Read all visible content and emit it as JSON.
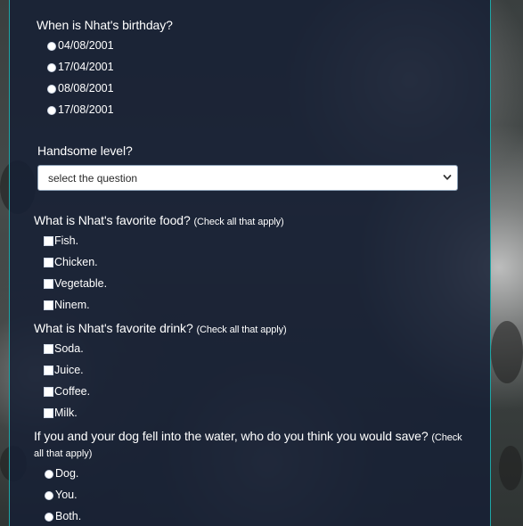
{
  "questions": {
    "birthday": {
      "label": "When is Nhat's birthday?",
      "options": [
        "04/08/2001",
        "17/04/2001",
        "08/08/2001",
        "17/08/2001"
      ]
    },
    "handsome": {
      "label": "Handsome level?",
      "select_value": "select the question"
    },
    "food": {
      "label": "What is Nhat's favorite food?",
      "note": "(Check all that apply)",
      "options": [
        "Fish.",
        "Chicken.",
        "Vegetable.",
        "Ninem."
      ]
    },
    "drink": {
      "label": "What is Nhat's favorite drink?",
      "note": "(Check all that apply)",
      "options": [
        "Soda.",
        "Juice.",
        "Coffee.",
        "Milk."
      ]
    },
    "dog": {
      "label": "If you and your dog fell into the water, who do you think you would save?",
      "note_part1": "(Check",
      "note_part2": "all that apply)",
      "options": [
        "Dog.",
        "You.",
        "Both."
      ]
    }
  },
  "icons": {
    "select_chevron": "chevron-down-icon"
  },
  "colors": {
    "panel": "#16203a",
    "border_accent": "#1fa6a6",
    "text": "#ffffff"
  }
}
